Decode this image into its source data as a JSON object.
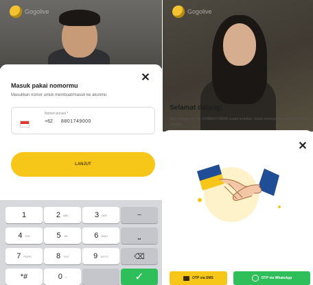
{
  "app": {
    "brand_name": "Gogolive",
    "brand_color": "#f6c619"
  },
  "login": {
    "title": "Masuk pakai nomormu",
    "subtitle": "Masukkan nomor untuk membuat/masuk ke akunmu",
    "close_icon": "close-icon",
    "phone_field": {
      "label": "Nomor ponsel *",
      "country_code": "+62",
      "value": "8801749000",
      "flag": "indonesia-flag-icon"
    },
    "continue_label": "LANJUT"
  },
  "keypad": {
    "keys": [
      {
        "digit": "1",
        "letters": ""
      },
      {
        "digit": "2",
        "letters": "ABC"
      },
      {
        "digit": "3",
        "letters": "DEF"
      },
      {
        "digit": "4",
        "letters": "GHI"
      },
      {
        "digit": "5",
        "letters": "JKL"
      },
      {
        "digit": "6",
        "letters": "MNO"
      },
      {
        "digit": "7",
        "letters": "PQRS"
      },
      {
        "digit": "8",
        "letters": "TUV"
      },
      {
        "digit": "9",
        "letters": "WXYZ"
      },
      {
        "digit": "*#",
        "letters": ""
      },
      {
        "digit": "0",
        "letters": "+"
      }
    ],
    "function_keys": {
      "minus": "−",
      "space": "⎵",
      "backspace": "⌫",
      "enter": "✓"
    },
    "enter_color": "#2fbf5a"
  },
  "welcome": {
    "close_icon": "close-icon",
    "title": "Selamat datang!",
    "text": "Akun dengan no. hp +6288801749000 sudah terdaftar. Untuk melanjutkan, lakukan verifikasi akunmu",
    "sms_label": "OTP via SMS",
    "sms_icon": "message-icon",
    "wa_label": "OTP via WhatsApp",
    "wa_icon": "whatsapp-icon",
    "illustration": "handshake-illustration"
  }
}
